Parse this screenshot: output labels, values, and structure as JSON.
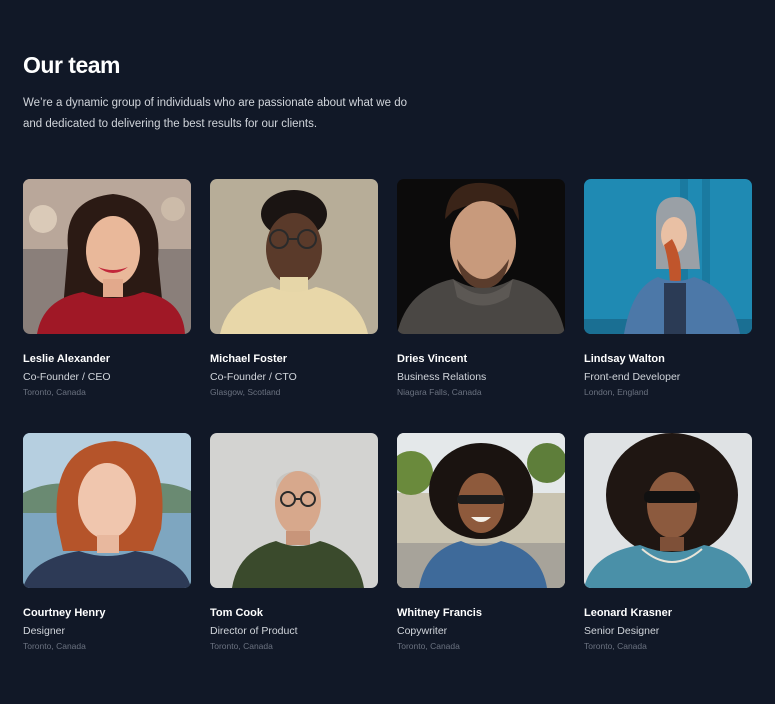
{
  "section": {
    "title": "Our team",
    "description": "We’re a dynamic group of individuals who are passionate about what we do and dedicated to delivering the best results for our clients."
  },
  "members": [
    {
      "name": "Leslie Alexander",
      "role": "Co-Founder / CEO",
      "location": "Toronto, Canada"
    },
    {
      "name": "Michael Foster",
      "role": "Co-Founder / CTO",
      "location": "Glasgow, Scotland"
    },
    {
      "name": "Dries Vincent",
      "role": "Business Relations",
      "location": "Niagara Falls, Canada"
    },
    {
      "name": "Lindsay Walton",
      "role": "Front-end Developer",
      "location": "London, England"
    },
    {
      "name": "Courtney Henry",
      "role": "Designer",
      "location": "Toronto, Canada"
    },
    {
      "name": "Tom Cook",
      "role": "Director of Product",
      "location": "Toronto, Canada"
    },
    {
      "name": "Whitney Francis",
      "role": "Copywriter",
      "location": "Toronto, Canada"
    },
    {
      "name": "Leonard Krasner",
      "role": "Senior Designer",
      "location": "Toronto, Canada"
    }
  ]
}
